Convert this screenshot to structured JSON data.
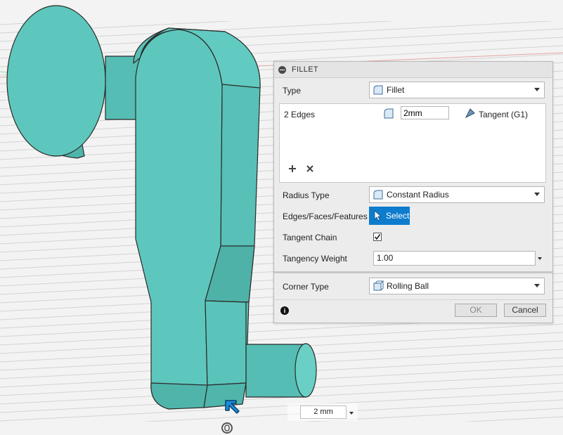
{
  "panel": {
    "title": "FILLET",
    "type_label": "Type",
    "type_value": "Fillet",
    "edges_label": "2 Edges",
    "radius_value": "2mm",
    "tangency_label": "Tangent (G1)",
    "radius_type_label": "Radius Type",
    "radius_type_value": "Constant Radius",
    "edges_faces_label": "Edges/Faces/Features",
    "select_label": "Select",
    "tangent_chain_label": "Tangent Chain",
    "tangent_chain_checked": true,
    "tangency_weight_label": "Tangency Weight",
    "tangency_weight_value": "1.00",
    "corner_type_label": "Corner Type",
    "corner_type_value": "Rolling Ball",
    "ok_label": "OK",
    "cancel_label": "Cancel"
  },
  "heads_up": {
    "value": "2 mm"
  },
  "icons": [
    "collapse-icon",
    "fillet-type-icon",
    "radius-icon",
    "tangent-icon",
    "add-icon",
    "remove-icon",
    "cursor-icon",
    "checkbox-icon",
    "info-icon",
    "fillet-manipulator-arrow-icon",
    "orbit-icon"
  ],
  "colors": {
    "part_fill": "#5ec7bd",
    "select_button": "#0e7ccd",
    "background": "#f2f2f2"
  }
}
